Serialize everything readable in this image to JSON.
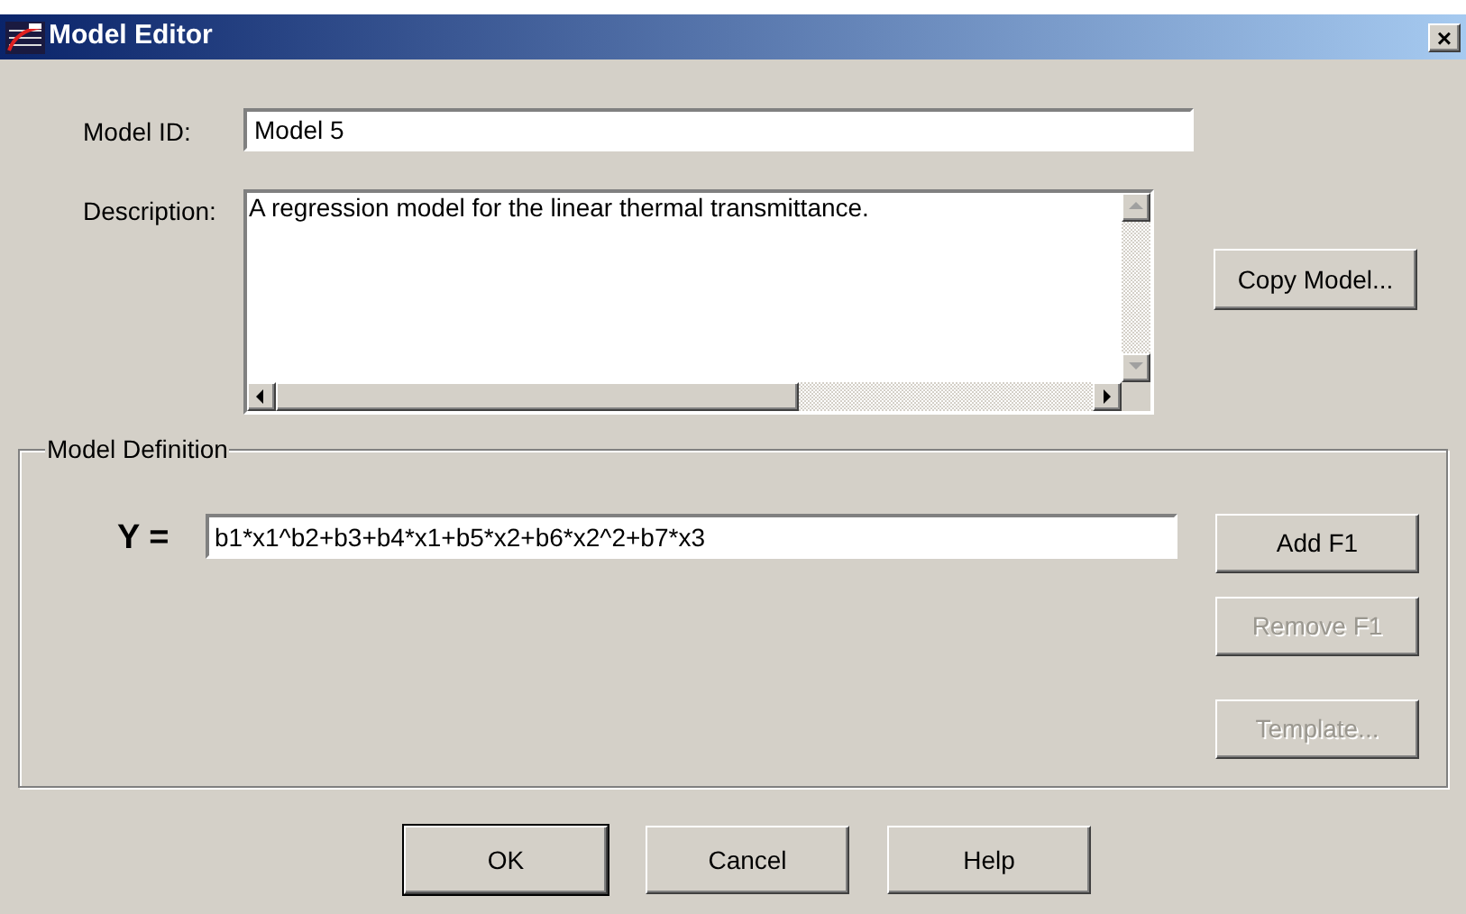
{
  "window": {
    "title": "Model Editor",
    "close": "×"
  },
  "model_id": {
    "label": "Model ID:",
    "value": "Model 5"
  },
  "description": {
    "label": "Description:",
    "value": "A regression model for the linear thermal transmittance."
  },
  "copy_button": {
    "label": "Copy Model...",
    "disabled": false
  },
  "model_definition": {
    "title": "Model Definition",
    "equation_label": "Y =",
    "equation": "b1*x1^b2+b3+b4*x1+b5*x2+b6*x2^2+b7*x3",
    "buttons": [
      {
        "label": "Add F1",
        "disabled": false
      },
      {
        "label": "Remove F1",
        "disabled": true
      },
      {
        "label": "Template...",
        "disabled": true
      }
    ]
  },
  "buttons": [
    {
      "label": "OK",
      "default": true
    },
    {
      "label": "Cancel",
      "default": false
    },
    {
      "label": "Help",
      "default": false
    }
  ]
}
